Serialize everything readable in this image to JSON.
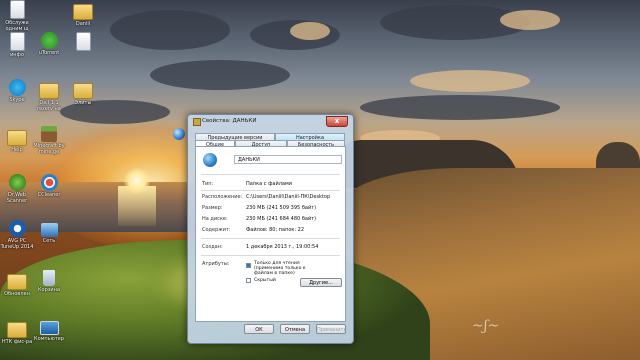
{
  "desktop": {
    "icons": [
      {
        "label": "Обслуже одним щ",
        "icon": "document-icon"
      },
      {
        "label": "Daniil",
        "icon": "folder-icon"
      },
      {
        "label": "инфо",
        "icon": "document-icon"
      },
      {
        "label": "uTorrent",
        "icon": "utorrent-icon"
      },
      {
        "label": "",
        "icon": "document-icon"
      },
      {
        "label": "Skype",
        "icon": "skype-icon"
      },
      {
        "label": "Dell 1.1 rezerv на",
        "icon": "folder-icon"
      },
      {
        "label": "Элиты",
        "icon": "folder-icon"
      },
      {
        "label": "Help",
        "icon": "folder-icon"
      },
      {
        "label": "Minecraft by mine.ge",
        "icon": "minecraft-icon"
      },
      {
        "label": "Dr.Web Scanner",
        "icon": "drweb-icon"
      },
      {
        "label": "CCleaner",
        "icon": "ccleaner-icon"
      },
      {
        "label": "AVG PC TuneUp 2014",
        "icon": "avg-icon"
      },
      {
        "label": "Сеть",
        "icon": "network-icon"
      },
      {
        "label": "Обновлен",
        "icon": "folder-icon"
      },
      {
        "label": "Корзина",
        "icon": "recycle-bin-icon"
      },
      {
        "label": "НТК фис-ра",
        "icon": "folder-icon"
      },
      {
        "label": "Компьютер",
        "icon": "computer-icon"
      }
    ]
  },
  "dialog": {
    "title": "Свойства: ДАНЬКИ",
    "close_label": "x",
    "tabs_back": [
      "Предыдущие версии",
      "Настройка"
    ],
    "tabs_front": [
      "Общие",
      "Доступ",
      "Безопасность"
    ],
    "folder_name": "ДАНЬКИ",
    "properties": [
      {
        "label": "Тип:",
        "value": "Папка с файлами"
      },
      {
        "label": "Расположение:",
        "value": "C:\\Users\\Daniil\\Daniil-ПК\\Desktop"
      },
      {
        "label": "Размер:",
        "value": "230 МБ (241 509 395 байт)"
      },
      {
        "label": "На диске:",
        "value": "230 МБ (241 684 480 байт)"
      },
      {
        "label": "Содержит:",
        "value": "Файлов: 80; папок: 22"
      },
      {
        "label": "Создан:",
        "value": "1 декабря 2013 г., 19:00:54"
      }
    ],
    "attributes_label": "Атрибуты:",
    "readonly_label": "Только для чтения (применимо только к файлам в папке)",
    "readonly_checked": true,
    "hidden_label": "Скрытый",
    "hidden_checked": false,
    "other_button": "Другие...",
    "ok_button": "ОК",
    "cancel_button": "Отмена",
    "apply_button": "Применить"
  }
}
